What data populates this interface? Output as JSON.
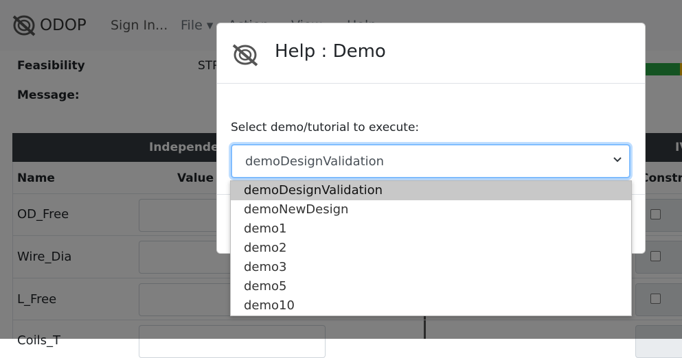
{
  "navbar": {
    "brand": "ODOP",
    "sign_in": "Sign In...",
    "file": "File ▾",
    "action": "Action",
    "view": "View",
    "help": "Help"
  },
  "status": {
    "feasibility_label": "Feasibility",
    "feasibility_value": "STR",
    "message_label": "Message:"
  },
  "table": {
    "section_header": "Independent",
    "right_header": "IV",
    "col_name": "Name",
    "col_value": "Value",
    "col_constraint": "Constra",
    "rows": [
      {
        "name": "OD_Free"
      },
      {
        "name": "Wire_Dia"
      },
      {
        "name": "L_Free"
      },
      {
        "name": "Coils_T"
      }
    ]
  },
  "modal": {
    "title": "Help : Demo",
    "select_label": "Select demo/tutorial to execute:",
    "selected_value": "demoDesignValidation",
    "options": [
      "demoDesignValidation",
      "demoNewDesign",
      "demo1",
      "demo2",
      "demo3",
      "demo5",
      "demo10"
    ]
  },
  "colors": {
    "accent": "#80bdff",
    "feasible": "#28a745",
    "dark_header": "#343a40"
  }
}
